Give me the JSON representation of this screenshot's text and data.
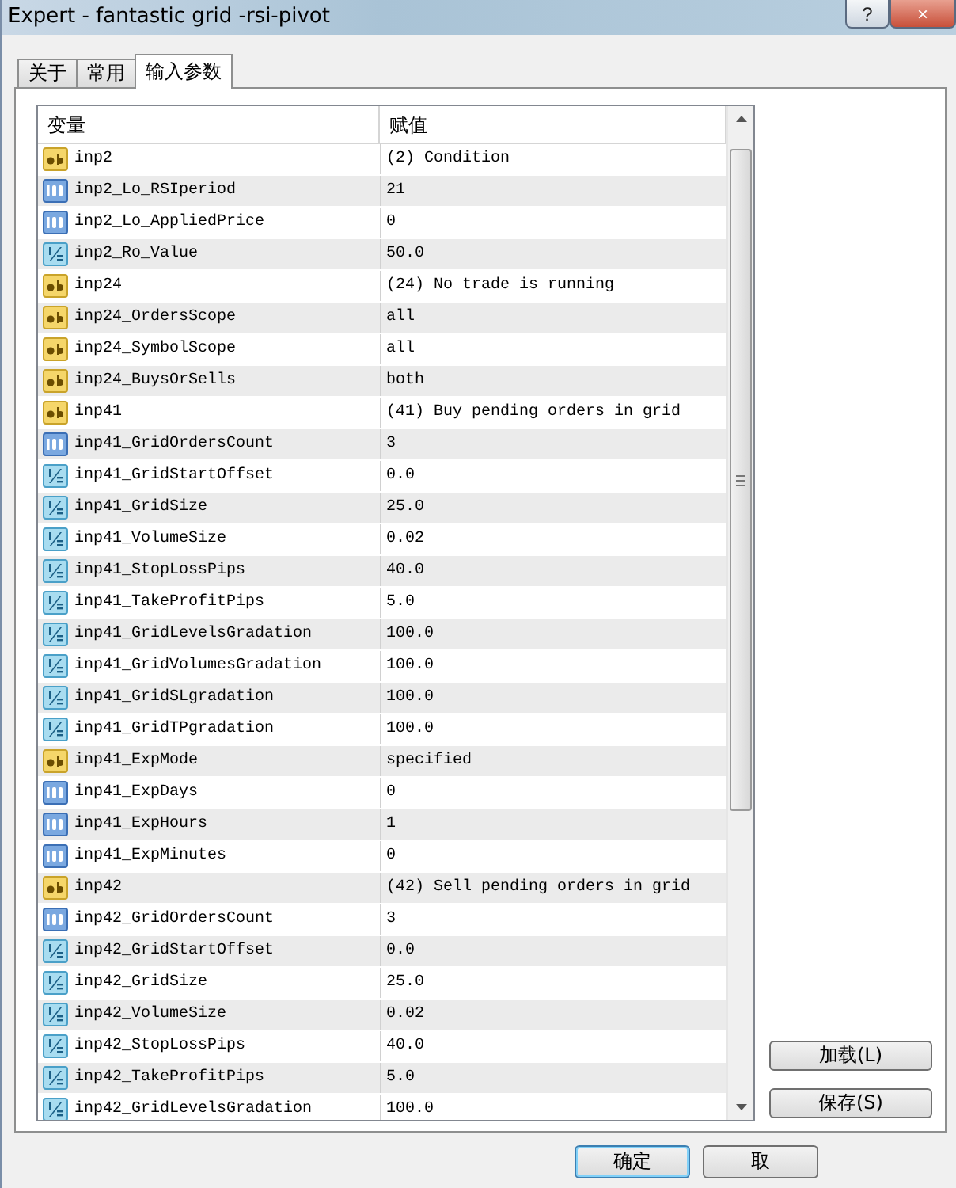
{
  "window": {
    "title": "Expert - fantastic grid -rsi-pivot",
    "help": "?",
    "close": "×"
  },
  "tabs": [
    {
      "label": "关于",
      "selected": false
    },
    {
      "label": "常用",
      "selected": false
    },
    {
      "label": "输入参数",
      "selected": true
    }
  ],
  "table": {
    "columns": [
      "变量",
      "赋值"
    ],
    "rows": [
      {
        "kind": "string",
        "name": "inp2",
        "value": "(2) Condition"
      },
      {
        "kind": "int",
        "name": "inp2_Lo_RSIperiod",
        "value": "21"
      },
      {
        "kind": "int",
        "name": "inp2_Lo_AppliedPrice",
        "value": "0"
      },
      {
        "kind": "double",
        "name": "inp2_Ro_Value",
        "value": "50.0"
      },
      {
        "kind": "string",
        "name": "inp24",
        "value": "(24) No trade is running"
      },
      {
        "kind": "string",
        "name": "inp24_OrdersScope",
        "value": "all"
      },
      {
        "kind": "string",
        "name": "inp24_SymbolScope",
        "value": "all"
      },
      {
        "kind": "string",
        "name": "inp24_BuysOrSells",
        "value": "both"
      },
      {
        "kind": "string",
        "name": "inp41",
        "value": "(41) Buy pending orders in grid"
      },
      {
        "kind": "int",
        "name": "inp41_GridOrdersCount",
        "value": "3"
      },
      {
        "kind": "double",
        "name": "inp41_GridStartOffset",
        "value": "0.0"
      },
      {
        "kind": "double",
        "name": "inp41_GridSize",
        "value": "25.0"
      },
      {
        "kind": "double",
        "name": "inp41_VolumeSize",
        "value": "0.02"
      },
      {
        "kind": "double",
        "name": "inp41_StopLossPips",
        "value": "40.0"
      },
      {
        "kind": "double",
        "name": "inp41_TakeProfitPips",
        "value": "5.0"
      },
      {
        "kind": "double",
        "name": "inp41_GridLevelsGradation",
        "value": "100.0"
      },
      {
        "kind": "double",
        "name": "inp41_GridVolumesGradation",
        "value": "100.0"
      },
      {
        "kind": "double",
        "name": "inp41_GridSLgradation",
        "value": "100.0"
      },
      {
        "kind": "double",
        "name": "inp41_GridTPgradation",
        "value": "100.0"
      },
      {
        "kind": "string",
        "name": "inp41_ExpMode",
        "value": "specified"
      },
      {
        "kind": "int",
        "name": "inp41_ExpDays",
        "value": "0"
      },
      {
        "kind": "int",
        "name": "inp41_ExpHours",
        "value": "1"
      },
      {
        "kind": "int",
        "name": "inp41_ExpMinutes",
        "value": "0"
      },
      {
        "kind": "string",
        "name": "inp42",
        "value": "(42) Sell pending orders in grid"
      },
      {
        "kind": "int",
        "name": "inp42_GridOrdersCount",
        "value": "3"
      },
      {
        "kind": "double",
        "name": "inp42_GridStartOffset",
        "value": "0.0"
      },
      {
        "kind": "double",
        "name": "inp42_GridSize",
        "value": "25.0"
      },
      {
        "kind": "double",
        "name": "inp42_VolumeSize",
        "value": "0.02"
      },
      {
        "kind": "double",
        "name": "inp42_StopLossPips",
        "value": "40.0"
      },
      {
        "kind": "double",
        "name": "inp42_TakeProfitPips",
        "value": "5.0"
      },
      {
        "kind": "double",
        "name": "inp42_GridLevelsGradation",
        "value": "100.0"
      }
    ]
  },
  "side_buttons": [
    "加载(L)",
    "保存(S)"
  ],
  "footer_buttons": [
    {
      "label": "确定",
      "selected": true
    },
    {
      "label": "取",
      "selected": false
    }
  ]
}
